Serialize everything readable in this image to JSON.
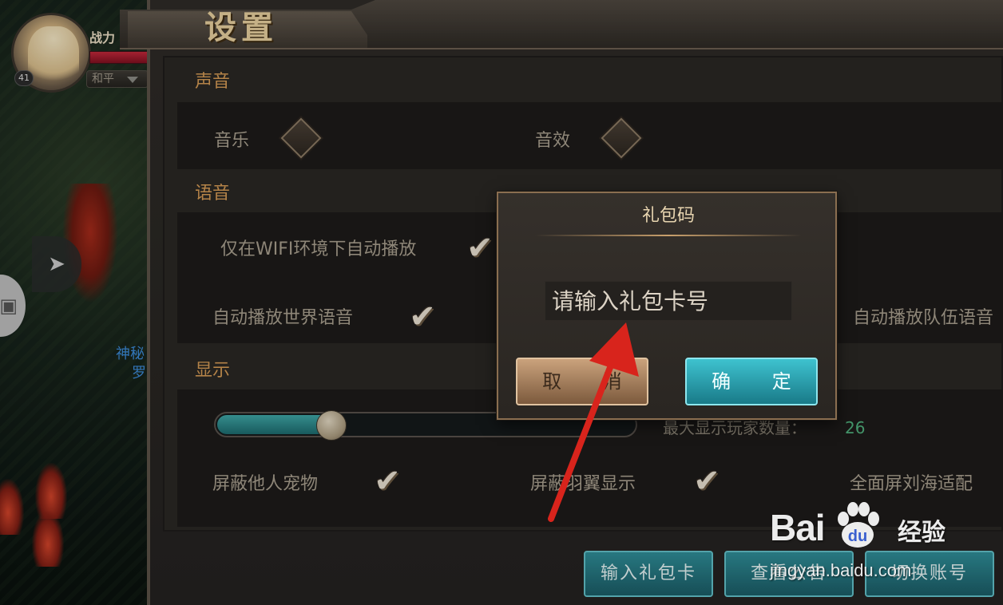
{
  "hud": {
    "power_label": "战力",
    "level": "41",
    "pk_mode": "和平",
    "npc_name_line1": "神秘",
    "npc_name_line2": "罗"
  },
  "settings": {
    "title": "设置",
    "sound": {
      "section_title": "声音",
      "music_label": "音乐",
      "sfx_label": "音效"
    },
    "voice": {
      "section_title": "语音",
      "wifi_autoplay_label": "仅在WIFI环境下自动播放",
      "wifi_autoplay_checked": true,
      "world_voice_label": "自动播放世界语音",
      "world_voice_checked": true,
      "team_voice_label": "自动播放队伍语音"
    },
    "display": {
      "section_title": "显示",
      "max_players_label": "最大显示玩家数量：",
      "max_players_value": "26",
      "slider_fraction": 0.27,
      "hide_pets_label": "屏蔽他人宠物",
      "hide_pets_checked": true,
      "hide_wings_label": "屏蔽羽翼显示",
      "hide_wings_checked": true,
      "notch_fit_label": "全面屏刘海适配"
    },
    "bottom_buttons": {
      "gift_card": "输入礼包卡",
      "middle": "查看公告",
      "switch_account": "切换账号"
    }
  },
  "dialog": {
    "title": "礼包码",
    "input_placeholder": "请输入礼包卡号",
    "input_value": "",
    "cancel_label": "取 消",
    "confirm_label": "确 定"
  },
  "watermark": {
    "brand": "Bai",
    "brand_tail": "du",
    "product": "经验",
    "url": "jingyan.baidu.com"
  },
  "colors": {
    "section_title": "#d49a55",
    "accent_teal": "#2f8d97",
    "annotation_arrow": "#d8241c"
  },
  "icons": {
    "sidebar_toggle": "chevron-right-icon",
    "checkbox_on": "checkmark-icon",
    "toggle_off": "diamond-toggle-icon"
  }
}
